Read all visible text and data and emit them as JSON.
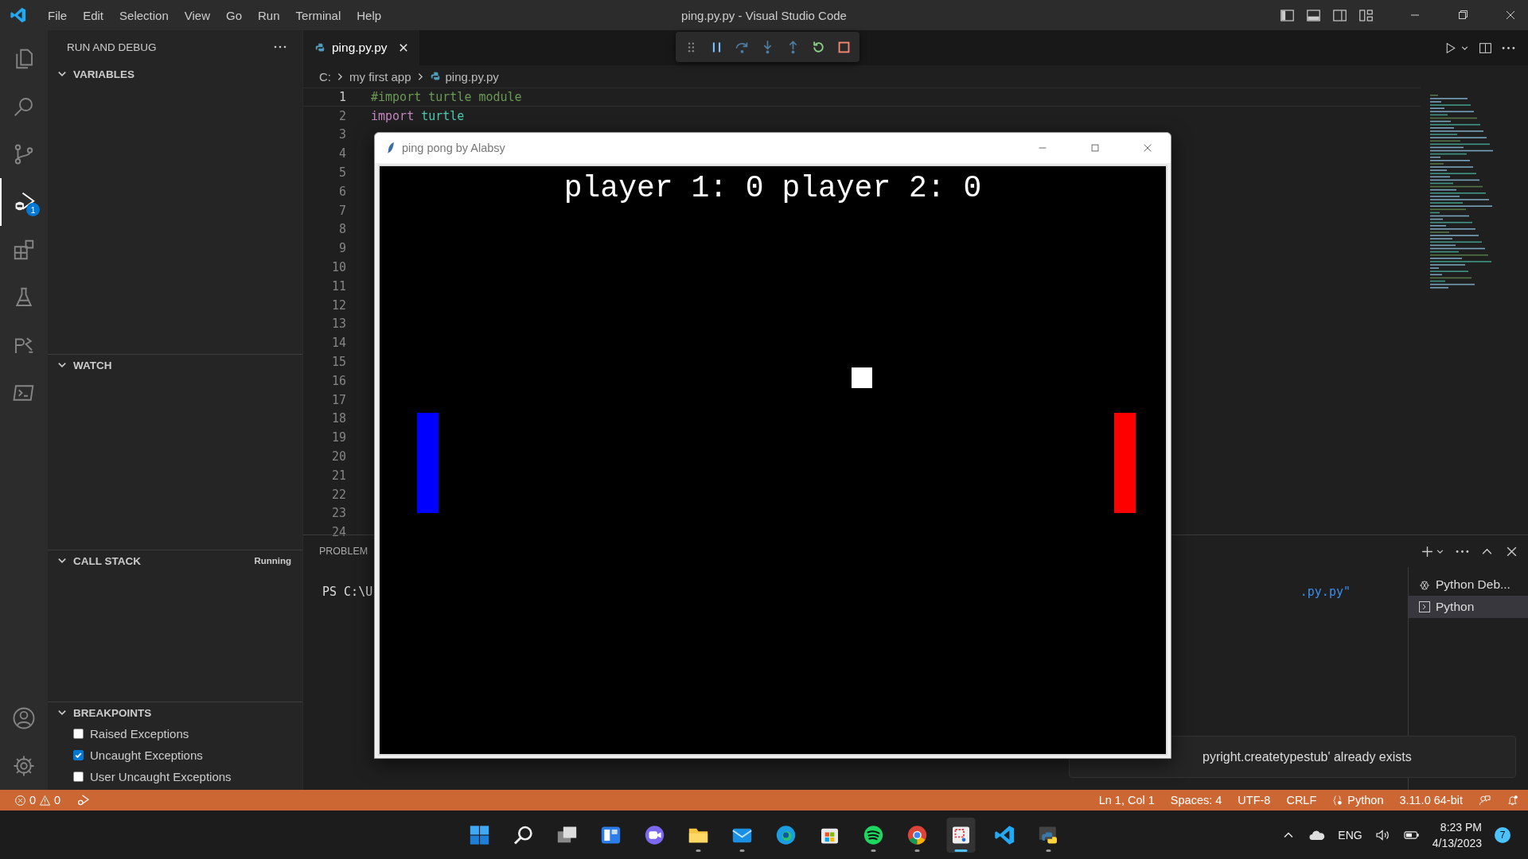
{
  "title_bar": {
    "menu": [
      "File",
      "Edit",
      "Selection",
      "View",
      "Go",
      "Run",
      "Terminal",
      "Help"
    ],
    "title": "ping.py.py - Visual Studio Code"
  },
  "activity_bar": {
    "items": [
      {
        "kind": "files",
        "selected": false
      },
      {
        "kind": "search",
        "selected": false
      },
      {
        "kind": "scm",
        "selected": false
      },
      {
        "kind": "debug",
        "selected": true,
        "badge": "1"
      },
      {
        "kind": "extensions",
        "selected": false
      },
      {
        "kind": "testing",
        "selected": false
      },
      {
        "kind": "python",
        "selected": false
      },
      {
        "kind": "terminal",
        "selected": false
      }
    ],
    "bottom": [
      {
        "kind": "account"
      },
      {
        "kind": "settings"
      }
    ]
  },
  "sidebar": {
    "title": "RUN AND DEBUG",
    "sections": [
      {
        "title": "VARIABLES",
        "expanded": true
      },
      {
        "title": "WATCH",
        "expanded": true
      },
      {
        "title": "CALL STACK",
        "expanded": true,
        "status": "Running"
      },
      {
        "title": "BREAKPOINTS",
        "expanded": true,
        "items": [
          {
            "label": "Raised Exceptions",
            "checked": false
          },
          {
            "label": "Uncaught Exceptions",
            "checked": true
          },
          {
            "label": "User Uncaught Exceptions",
            "checked": false
          }
        ]
      }
    ]
  },
  "editor": {
    "tabs": [
      {
        "label": "ping.py.py",
        "selected": true
      }
    ],
    "breadcrumbs": [
      "C:",
      "my first app",
      "ping.py.py"
    ],
    "lines": [
      {
        "number": "1",
        "current": true,
        "tokens": [
          {
            "text": "#import turtle module",
            "kind": "comment"
          }
        ]
      },
      {
        "number": "2",
        "current": false,
        "tokens": [
          {
            "text": "import",
            "kind": "keyword"
          },
          {
            "text": " turtle",
            "kind": "module"
          }
        ]
      },
      {
        "number": "3",
        "current": false
      },
      {
        "number": "4",
        "current": false
      },
      {
        "number": "5",
        "current": false
      },
      {
        "number": "6",
        "current": false
      },
      {
        "number": "7",
        "current": false
      },
      {
        "number": "8",
        "current": false
      },
      {
        "number": "9",
        "current": false
      },
      {
        "number": "10",
        "current": false
      },
      {
        "number": "11",
        "current": false
      },
      {
        "number": "12",
        "current": false
      },
      {
        "number": "13",
        "current": false
      },
      {
        "number": "14",
        "current": false
      },
      {
        "number": "15",
        "current": false
      },
      {
        "number": "16",
        "current": false
      },
      {
        "number": "17",
        "current": false
      },
      {
        "number": "18",
        "current": false
      },
      {
        "number": "19",
        "current": false
      },
      {
        "number": "20",
        "current": false
      },
      {
        "number": "21",
        "current": false
      },
      {
        "number": "22",
        "current": false
      },
      {
        "number": "23",
        "current": false
      },
      {
        "number": "24",
        "current": false
      }
    ]
  },
  "panel": {
    "tabs": [
      "PROBLEM"
    ],
    "terminal_text": "PS C:\\U",
    "terminal_tail": ".py.py\"",
    "terminals": [
      {
        "label": "Python Deb...",
        "kind": "debug",
        "selected": false
      },
      {
        "label": "Python",
        "kind": "shell",
        "selected": true
      }
    ]
  },
  "game_window": {
    "title": "ping pong by Alabsy",
    "score": "player 1: 0 player 2: 0",
    "paddles": [
      {
        "color": "#0000ff"
      },
      {
        "color": "#ff0000"
      }
    ]
  },
  "notification": {
    "message": "pyright.createtypestub' already exists"
  },
  "status_bar": {
    "errors": "0",
    "warnings": "0",
    "items": [
      {
        "text": "Ln 1, Col 1",
        "kind": "plain"
      },
      {
        "text": "Spaces: 4",
        "kind": "plain"
      },
      {
        "text": "UTF-8",
        "kind": "plain"
      },
      {
        "text": "CRLF",
        "kind": "plain"
      },
      {
        "text": "Python",
        "kind": "language"
      },
      {
        "text": "3.11.0 64-bit",
        "kind": "plain"
      }
    ]
  },
  "taskbar": {
    "apps": [
      {
        "kind": "start",
        "running": false,
        "selected": false
      },
      {
        "kind": "search",
        "running": false,
        "selected": false
      },
      {
        "kind": "taskview",
        "running": false,
        "selected": false
      },
      {
        "kind": "widgets",
        "running": false,
        "selected": false
      },
      {
        "kind": "chat",
        "running": false,
        "selected": false
      },
      {
        "kind": "folder",
        "running": true,
        "selected": false
      },
      {
        "kind": "mail",
        "running": true,
        "selected": false
      },
      {
        "kind": "browser",
        "running": false,
        "selected": false
      },
      {
        "kind": "store",
        "running": false,
        "selected": false
      },
      {
        "kind": "music",
        "running": true,
        "selected": false
      },
      {
        "kind": "chrome",
        "running": true,
        "selected": false
      },
      {
        "kind": "snip",
        "running": true,
        "selected": true
      },
      {
        "kind": "code",
        "running": false,
        "selected": false
      },
      {
        "kind": "python",
        "running": true,
        "selected": false
      }
    ],
    "language": "ENG",
    "time": "8:23 PM",
    "date": "4/13/2023",
    "notifications": "7"
  }
}
